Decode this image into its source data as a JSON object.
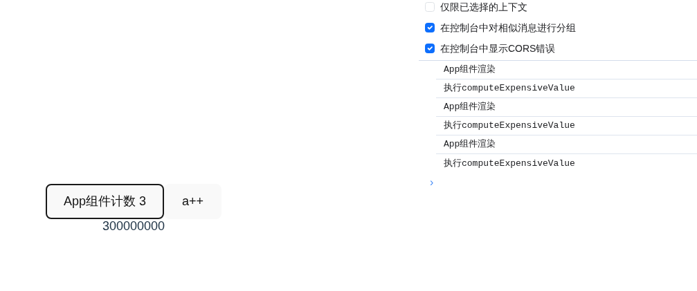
{
  "app": {
    "buttons": [
      {
        "label": "App组件计数 3",
        "kind": "outlined"
      },
      {
        "label": "a++",
        "kind": "plain"
      }
    ],
    "result": "300000000"
  },
  "console": {
    "settings": [
      {
        "label": "仅限已选择的上下文",
        "checked": false
      },
      {
        "label": "在控制台中对相似消息进行分组",
        "checked": true
      },
      {
        "label": "在控制台中显示CORS错误",
        "checked": true
      }
    ],
    "messages": [
      "App组件渲染",
      "执行computeExpensiveValue",
      "App组件渲染",
      "执行computeExpensiveValue",
      "App组件渲染",
      "执行computeExpensiveValue"
    ],
    "prompt": "›"
  }
}
